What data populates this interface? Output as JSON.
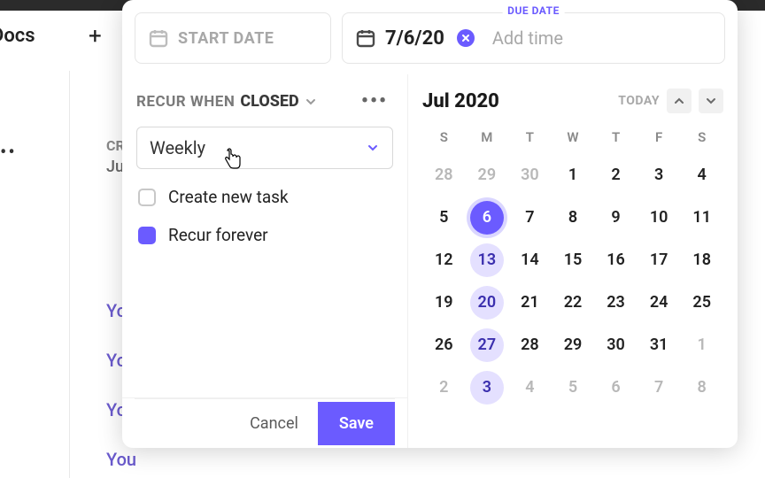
{
  "background": {
    "breadcrumb": "Docs",
    "faded_items": [
      "CR",
      "Ju",
      "Yo",
      "Yo",
      "Yo",
      "You"
    ]
  },
  "date_inputs": {
    "start_placeholder": "START DATE",
    "due_label": "DUE DATE",
    "due_value": "7/6/20",
    "add_time": "Add time"
  },
  "recur": {
    "when_label": "RECUR WHEN",
    "status": "CLOSED",
    "frequency": "Weekly",
    "create_new_task_label": "Create new task",
    "create_new_task_checked": false,
    "recur_forever_label": "Recur forever",
    "recur_forever_checked": true
  },
  "footer": {
    "cancel": "Cancel",
    "save": "Save"
  },
  "calendar": {
    "month_title": "Jul 2020",
    "today_label": "TODAY",
    "dow": [
      "S",
      "M",
      "T",
      "W",
      "T",
      "F",
      "S"
    ],
    "weeks": [
      [
        {
          "n": 28,
          "other": true
        },
        {
          "n": 29,
          "other": true
        },
        {
          "n": 30,
          "other": true
        },
        {
          "n": 1
        },
        {
          "n": 2
        },
        {
          "n": 3
        },
        {
          "n": 4
        }
      ],
      [
        {
          "n": 5
        },
        {
          "n": 6,
          "selected": true
        },
        {
          "n": 7
        },
        {
          "n": 8
        },
        {
          "n": 9
        },
        {
          "n": 10
        },
        {
          "n": 11
        }
      ],
      [
        {
          "n": 12
        },
        {
          "n": 13,
          "hl": true
        },
        {
          "n": 14
        },
        {
          "n": 15
        },
        {
          "n": 16
        },
        {
          "n": 17
        },
        {
          "n": 18
        }
      ],
      [
        {
          "n": 19
        },
        {
          "n": 20,
          "hl": true
        },
        {
          "n": 21
        },
        {
          "n": 22
        },
        {
          "n": 23
        },
        {
          "n": 24
        },
        {
          "n": 25
        }
      ],
      [
        {
          "n": 26
        },
        {
          "n": 27,
          "hl": true
        },
        {
          "n": 28
        },
        {
          "n": 29
        },
        {
          "n": 30
        },
        {
          "n": 31
        },
        {
          "n": 1,
          "other": true
        }
      ],
      [
        {
          "n": 2,
          "other": true
        },
        {
          "n": 3,
          "other": true,
          "hl": true
        },
        {
          "n": 4,
          "other": true
        },
        {
          "n": 5,
          "other": true
        },
        {
          "n": 6,
          "other": true
        },
        {
          "n": 7,
          "other": true
        },
        {
          "n": 8,
          "other": true
        }
      ]
    ]
  }
}
